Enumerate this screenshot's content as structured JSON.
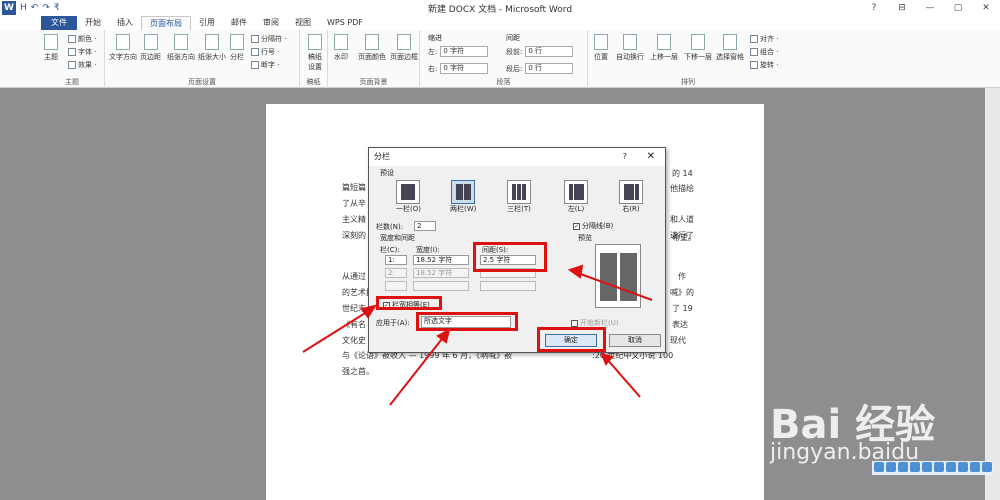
{
  "app": {
    "title": "新建 DOCX 文档 - Microsoft Word",
    "logo": "W",
    "qat": [
      "H",
      "↶",
      "↷",
      "₹"
    ],
    "win_buttons": [
      "?",
      "⊟",
      "—",
      "▢",
      "✕"
    ]
  },
  "tabs": [
    "文件",
    "开始",
    "插入",
    "页面布局",
    "引用",
    "邮件",
    "审阅",
    "视图",
    "WPS PDF"
  ],
  "ribbon": {
    "themes": {
      "label": "主题",
      "main": "主题",
      "items": [
        "颜色 ·",
        "字体 ·",
        "效果 ·"
      ]
    },
    "page_setup": {
      "label": "页面设置",
      "buttons": [
        "文字方向",
        "页边距",
        "纸张方向",
        "纸张大小",
        "分栏"
      ],
      "small": [
        "分隔符 ·",
        "行号 ·",
        "断字 ·"
      ]
    },
    "draft": {
      "label": "稿纸",
      "button": "稿纸设置"
    },
    "background": {
      "label": "页面背景",
      "buttons": [
        "水印",
        "页面颜色",
        "页面边框"
      ]
    },
    "paragraph": {
      "label": "段落",
      "indent": "缩进",
      "spacing": "间距",
      "left": "左:",
      "right": "右:",
      "before": "段前:",
      "after": "段后:",
      "indent_left": "0 字符",
      "indent_right": "0 字符",
      "space_before": "0 行",
      "space_after": "0 行"
    },
    "arrange": {
      "label": "排列",
      "buttons": [
        "位置",
        "自动换行",
        "上移一层",
        "下移一层",
        "选择窗格"
      ],
      "small": [
        "对齐 ·",
        "组合 ·",
        "旋转 ·"
      ]
    }
  },
  "doc": {
    "lines": [
      "篇短篇",
      "了从辛",
      "主义精",
      "深刻的",
      "从通过",
      "的艺术技",
      "世纪末",
      "《有名",
      "文化史",
      "与《论语》被收入 —  1999 年 6 月，《呐喊》被",
      ":20 世纪中文小说 100",
      "强之首。"
    ],
    "right": [
      "的 14",
      "他描绘",
      "和人道",
      "进行了",
      "希望。",
      "作",
      "喊》的",
      "了 19",
      "表达",
      "现代",
      "喊"
    ]
  },
  "dialog": {
    "title": "分栏",
    "help": "?",
    "close": "✕",
    "preset_label": "预设",
    "presets": [
      {
        "label": "一栏(O)",
        "cols": 1
      },
      {
        "label": "两栏(W)",
        "cols": 2
      },
      {
        "label": "三栏(T)",
        "cols": 3
      },
      {
        "label": "左(L)",
        "cols": 2
      },
      {
        "label": "右(R)",
        "cols": 2
      }
    ],
    "cols_label": "栏数(N):",
    "cols_value": "2",
    "line_between": "分隔线(B)",
    "width_spacing": "宽度和间距",
    "preview": "预览",
    "col_hdr": "栏(C):",
    "width_hdr": "宽度(I):",
    "spacing_hdr": "间距(S):",
    "rows": [
      {
        "c": "1:",
        "w": "18.52 字符",
        "s": "2.5 字符"
      },
      {
        "c": "2:",
        "w": "18.52 字符",
        "s": ""
      },
      {
        "c": "",
        "w": "",
        "s": ""
      }
    ],
    "equal_width": "栏宽相等(E)",
    "apply_label": "应用于(A):",
    "apply_value": "所选文字",
    "new_col": "开始新栏(U)",
    "ok": "确定",
    "cancel": "取消"
  },
  "watermark": {
    "main": "Bai 经验",
    "sub": "jingyan.baidu"
  },
  "colors": {
    "brand": "#2b579a",
    "highlight": "#d11111"
  }
}
